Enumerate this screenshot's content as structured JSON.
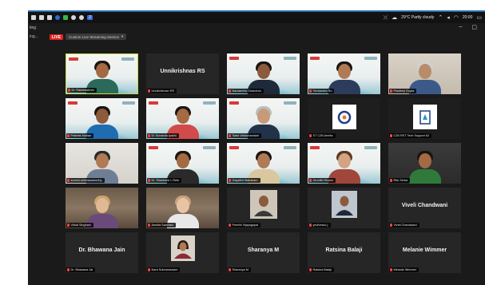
{
  "taskbar": {
    "badge_number": "2",
    "weather": "29°C  Partly cloudy",
    "clock": "20:00"
  },
  "titlebar": {
    "title": "ting"
  },
  "toolbar": {
    "view_label": "ing...",
    "live_label": "LIVE",
    "stream_label": "Custom Live Streaming Service",
    "stream_caret": "▾"
  },
  "participants": [
    {
      "label": "Dr. Rakshashree",
      "display_name": ""
    },
    {
      "label": "Unnikrishnan RS",
      "display_name": "Unnikrishnas RS"
    },
    {
      "label": "Narasimha Ghandran",
      "display_name": ""
    },
    {
      "label": "Yechandra Ro",
      "display_name": ""
    },
    {
      "label": "Pradeep Gupta",
      "display_name": ""
    },
    {
      "label": "Prateek Mahan",
      "display_name": ""
    },
    {
      "label": "Dr Sunanda Iyakhi",
      "display_name": ""
    },
    {
      "label": "Satia Vellachandani",
      "display_name": ""
    },
    {
      "label": "ST C2B Amrita",
      "display_name": ""
    },
    {
      "label": "C2B RST Tech Support #2",
      "display_name": ""
    },
    {
      "label": "suresh.srinivasamurthy",
      "display_name": ""
    },
    {
      "label": "Dr. Shashank L Rele",
      "display_name": ""
    },
    {
      "label": "Gayathri Mahakam",
      "display_name": ""
    },
    {
      "label": "Jennifer Brown",
      "display_name": ""
    },
    {
      "label": "Ritu Sinha",
      "display_name": ""
    },
    {
      "label": "Vibuti Singhani",
      "display_name": ""
    },
    {
      "label": "Amelia Sanchez",
      "display_name": ""
    },
    {
      "label": "Preethi Vijayagopal",
      "display_name": ""
    },
    {
      "label": "yeclhesso j.",
      "display_name": ""
    },
    {
      "label": "Viveli Chandwani",
      "display_name": "Viveli Chandwani"
    },
    {
      "label": "Dr. Bhawana Jai",
      "display_name": "Dr. Bhawana Jain"
    },
    {
      "label": "Nara Subramaniam",
      "display_name": ""
    },
    {
      "label": "Sharanya M",
      "display_name": "Sharanya M"
    },
    {
      "label": "Ratsina Balaji",
      "display_name": "Ratsina Balaji"
    },
    {
      "label": "Melanie Wimmer",
      "display_name": "Melanie Wimmer"
    }
  ]
}
